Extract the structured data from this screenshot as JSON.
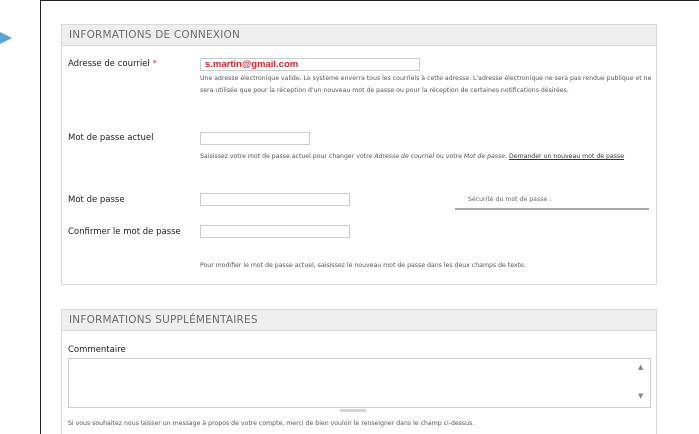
{
  "connexion": {
    "title": "INFORMATIONS DE CONNEXION",
    "email": {
      "label": "Adresse de courriel",
      "required_mark": "*",
      "value": "s.martin@gmail.com",
      "help": "Une adresse électronique valide. Le système enverra tous les courriels à cette adresse. L'adresse électronique ne sera pas rendue publique et ne sera utilisée que pour la réception d'un nouveau mot de passe ou pour la réception de certaines notifications désirées."
    },
    "current_password": {
      "label": "Mot de passe actuel",
      "help_before": "Saisissez votre mot de passe actuel pour changer votre ",
      "help_em1": "Adresse de courriel",
      "help_mid": " ou votre ",
      "help_em2": "Mot de passe",
      "help_after": ". ",
      "help_link": "Demander un nouveau mot de passe"
    },
    "password": {
      "label": "Mot de passe",
      "strength_label": "Sécurité du mot de passe :"
    },
    "confirm": {
      "label": "Confirmer le mot de passe",
      "help": "Pour modifier le mot de passe actuel, saisissez le nouveau mot de passe dans les deux champs de texte."
    }
  },
  "supplementaires": {
    "title": "INFORMATIONS SUPPLÉMENTAIRES",
    "comment": {
      "label": "Commentaire",
      "help": "Si vous souhaitez nous laisser un message à propos de votre compte, merci de bien vouloir le renseigner dans le champ ci-dessus."
    }
  },
  "colors": {
    "accent_arrow": "#59a4d4",
    "required": "#e03030",
    "email_text": "#e0242a"
  }
}
